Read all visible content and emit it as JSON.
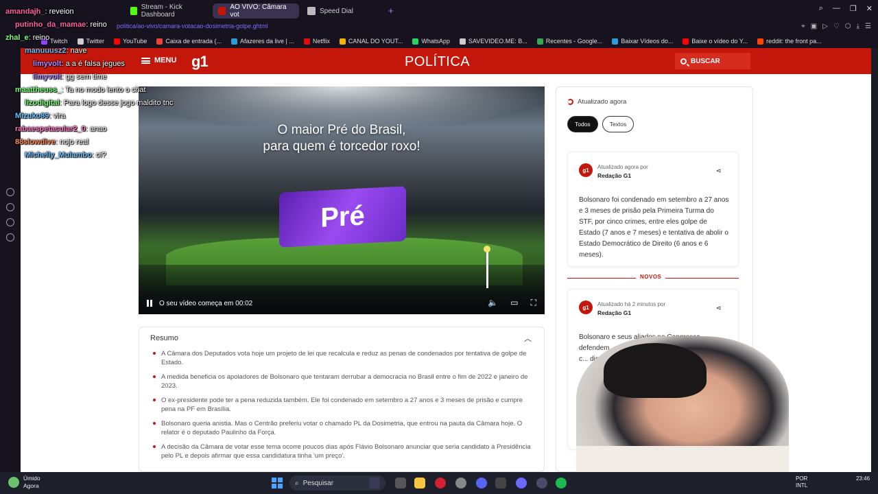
{
  "browser": {
    "tabs": [
      {
        "label": "Stream - Kick Dashboard",
        "active": false,
        "icon_color": "#53fc18"
      },
      {
        "label": "AO VIVO: Câmara vot",
        "active": true,
        "icon_color": "#c4170c"
      },
      {
        "label": "Speed Dial",
        "active": false,
        "icon_color": "#bbbbbb"
      }
    ],
    "new_tab": "+",
    "url": "politica/ao-vivo/camara-votacao-dosimetria-golpe.ghtml",
    "bookmarks": [
      {
        "label": "Twitch",
        "color": "#9146ff"
      },
      {
        "label": "Twitter",
        "color": "#cccccc"
      },
      {
        "label": "YouTube",
        "color": "#ff0000"
      },
      {
        "label": "Caixa de entrada (...",
        "color": "#ea4335"
      },
      {
        "label": "Afazeres da live | ...",
        "color": "#2d9cdb"
      },
      {
        "label": "Netflix",
        "color": "#e50914"
      },
      {
        "label": "CANAL DO YOUT...",
        "color": "#f4b400"
      },
      {
        "label": "WhatsApp",
        "color": "#25d366"
      },
      {
        "label": "SAVEVIDEO.ME: B...",
        "color": "#cccccc"
      },
      {
        "label": "Recentes - Google...",
        "color": "#34a853"
      },
      {
        "label": "Baixar Vídeos do...",
        "color": "#2d9cdb"
      },
      {
        "label": "Baixe o vídeo do Y...",
        "color": "#ff0000"
      },
      {
        "label": "reddit: the front pa...",
        "color": "#ff4500"
      }
    ]
  },
  "header": {
    "menu_label": "MENU",
    "logo": "g1",
    "section": "POLÍTICA",
    "search_label": "BUSCAR"
  },
  "video": {
    "promo_line1": "O maior Pré do Brasil,",
    "promo_line2": "para quem é torcedor roxo!",
    "flag_text": "Pré",
    "status": "O seu vídeo começa em 00:02"
  },
  "resumo": {
    "title": "Resumo",
    "items": [
      "A Câmara dos Deputados vota hoje um projeto de lei que recalcula e reduz as penas de condenados por tentativa de golpe de Estado.",
      "A medida beneficia os apoiadores de Bolsonaro que tentaram derrubar a democracia no Brasil entre o fim de 2022 e janeiro de 2023.",
      "O ex-presidente pode ter a pena reduzida também. Ele foi condenado em setembro a 27 anos e 3 meses de prisão e cumpre pena na PF em Brasília.",
      "Bolsonaro queria anistia. Mas o Centrão preferiu votar o chamado PL da Dosimetria, que entrou na pauta da Câmara hoje. O relator é o deputado Paulinho da Força.",
      "A decisão da Câmara de votar esse tema ocorre poucos dias após Flávio Bolsonaro anunciar que seria candidato à Presidência pelo PL e depois afirmar que essa candidatura tinha 'um preço'."
    ]
  },
  "live": {
    "updated": "Atualizado agora",
    "filters": [
      "Todos",
      "Textos"
    ],
    "novos": "NOVOS",
    "cards": [
      {
        "meta": "Atualizado agora por",
        "author": "Redação G1",
        "text": "Bolsonaro foi condenado em setembro a 27 anos e 3 meses de prisão pela Primeira Turma do STF, por cinco crimes, entre eles golpe de Estado (7 anos e 7 meses) e tentativa de abolir o Estado Democrático de Direito (6 anos e 6 meses)."
      },
      {
        "meta": "Atualizado há 2 minutos por",
        "author": "Redação G1",
        "text": "Bolsonaro e seus aliados no Congresso defendem... em discussão não pre... penas. Mais c... disse que a... golp... so..."
      }
    ]
  },
  "chat": [
    {
      "user": "amandajh_",
      "msg": "reveion",
      "color": "#ff5fa2"
    },
    {
      "user": "putinho_da_mamae",
      "msg": "reino",
      "color": "#ff5fa2"
    },
    {
      "user": "zhal_e",
      "msg": "reino",
      "color": "#7cff7c"
    },
    {
      "user": "manuuusz2",
      "msg": "nave",
      "color": "#6ec1ff"
    },
    {
      "user": "limyvolt",
      "msg": "a a é falsa jegues",
      "color": "#b58cff"
    },
    {
      "user": "limyvolt",
      "msg": "gg sem time",
      "color": "#b58cff"
    },
    {
      "user": "maattheuss_",
      "msg": "Ta no modo lento o chat",
      "color": "#7cff7c"
    },
    {
      "user": "lizodigital",
      "msg": "Para logo desse jogo maldito tnc",
      "color": "#7cff7c"
    },
    {
      "user": "Mizuko89",
      "msg": "vira",
      "color": "#6ec1ff"
    },
    {
      "user": "rabaespetacular2_0",
      "msg": "anao",
      "color": "#ff79c6"
    },
    {
      "user": "88slowdive",
      "msg": "nojo real",
      "color": "#ff8c5a"
    },
    {
      "user": "Michelly_Mulambo",
      "msg": "oi?",
      "color": "#6ec1ff"
    }
  ],
  "taskbar": {
    "weather_label": "Úmido",
    "weather_sub": "Agora",
    "search_label": "Pesquisar",
    "lang": "POR",
    "lang_sub": "INTL",
    "time": "23:46"
  }
}
